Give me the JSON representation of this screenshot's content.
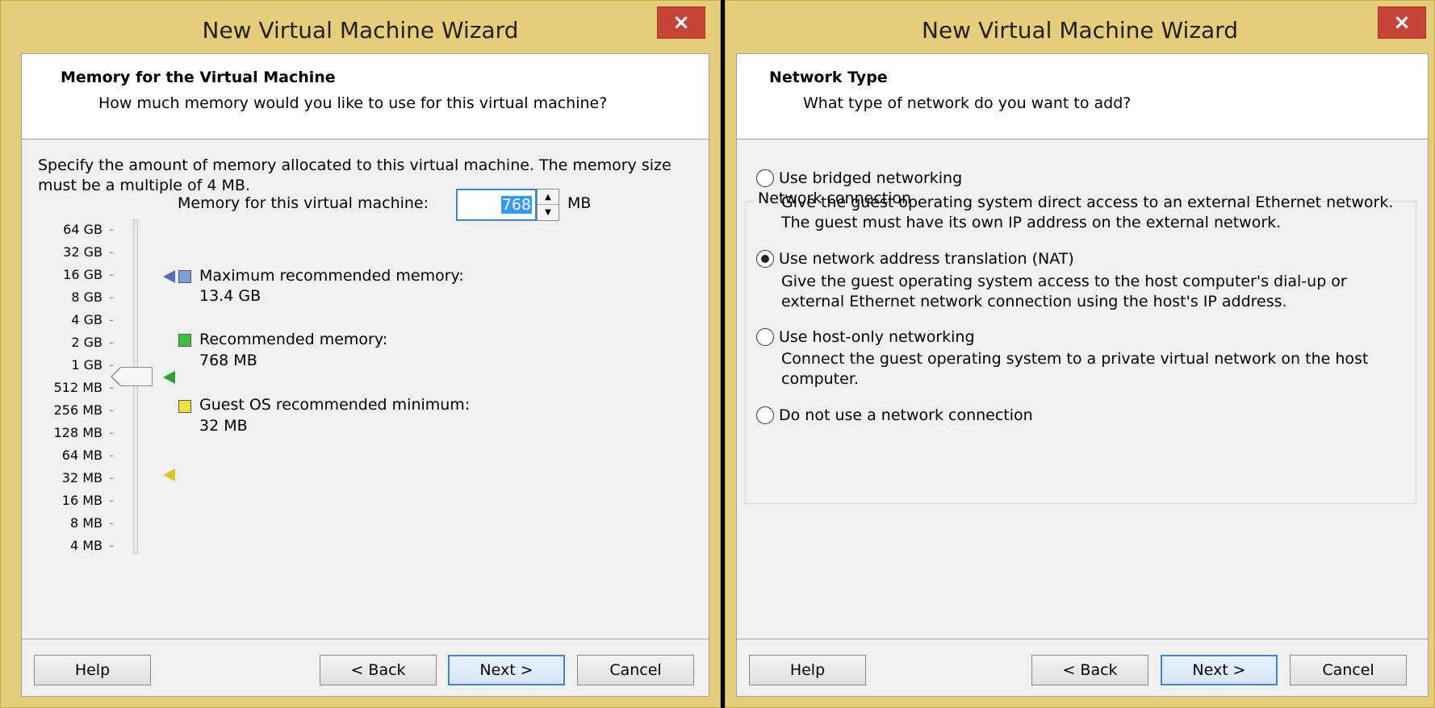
{
  "memory_window": {
    "title": "New Virtual Machine Wizard",
    "close_label": "×",
    "header_title": "Memory for the Virtual Machine",
    "header_subtitle": "How much memory would you like to use for this virtual machine?",
    "description": "Specify the amount of memory allocated to this virtual machine. The memory size must be a multiple of 4 MB.",
    "memory_label": "Memory for this virtual machine:",
    "memory_value": "768",
    "memory_unit": "MB",
    "scale_ticks": [
      "64 GB",
      "32 GB",
      "16 GB",
      "8 GB",
      "4 GB",
      "2 GB",
      "1 GB",
      "512 MB",
      "256 MB",
      "128 MB",
      "64 MB",
      "32 MB",
      "16 MB",
      "8 MB",
      "4 MB"
    ],
    "legend": [
      {
        "label": "Maximum recommended memory:",
        "value": "13.4 GB",
        "color": "#7f9fd8"
      },
      {
        "label": "Recommended memory:",
        "value": "768 MB",
        "color": "#3cc33c"
      },
      {
        "label": "Guest OS recommended minimum:",
        "value": "32 MB",
        "color": "#f0e040"
      }
    ],
    "buttons": {
      "help": "Help",
      "back": "< Back",
      "next": "Next >",
      "cancel": "Cancel"
    }
  },
  "network_window": {
    "title": "New Virtual Machine Wizard",
    "close_label": "×",
    "header_title": "Network Type",
    "header_subtitle": "What type of network do you want to add?",
    "group_title": "Network connection",
    "options": [
      {
        "label": "Use bridged networking",
        "checked": false,
        "description": "Give the guest operating system direct access to an external Ethernet network. The guest must have its own IP address on the external network."
      },
      {
        "label": "Use network address translation (NAT)",
        "checked": true,
        "description": "Give the guest operating system access to the host computer's dial-up or external Ethernet network connection using the host's IP address."
      },
      {
        "label": "Use host-only networking",
        "checked": false,
        "description": "Connect the guest operating system to a private virtual network on the host computer."
      },
      {
        "label": "Do not use a network connection",
        "checked": false,
        "description": ""
      }
    ],
    "buttons": {
      "help": "Help",
      "back": "< Back",
      "next": "Next >",
      "cancel": "Cancel"
    }
  }
}
